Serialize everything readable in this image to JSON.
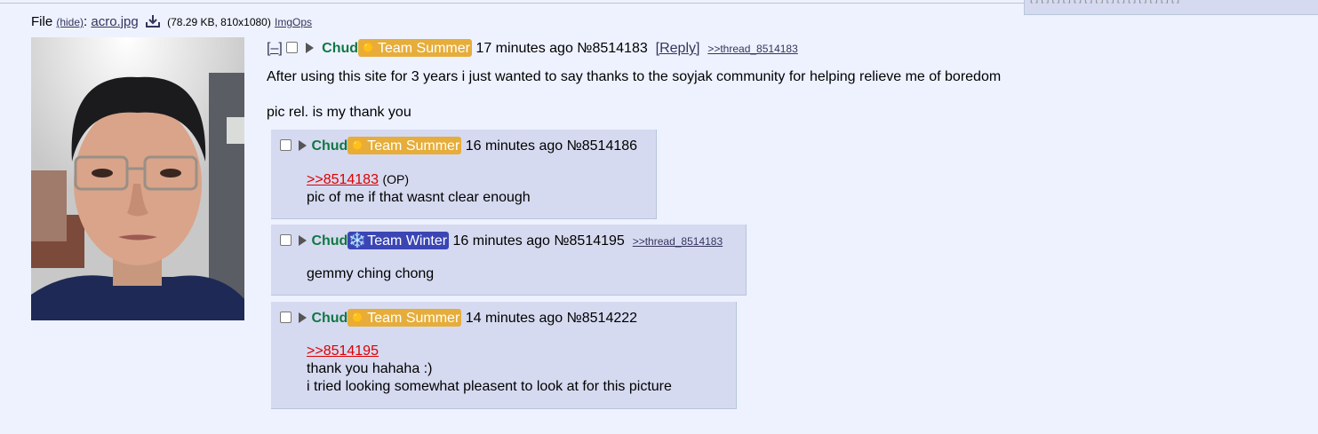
{
  "pagination_fragments": [
    "[",
    ")",
    "]",
    "[",
    "]",
    "[",
    "]",
    "[",
    "]",
    "[",
    "]",
    "[",
    "]",
    "[",
    "]",
    "[",
    "]",
    "[",
    "]",
    "[",
    "]",
    "[",
    "]"
  ],
  "file": {
    "label": "File",
    "hide": "(hide)",
    "name": "acro.jpg",
    "size": "(78.29 KB, 810x1080)",
    "imgops": "ImgOps",
    "icon": "download-icon"
  },
  "op": {
    "hide": "[–]",
    "name": "Chud",
    "flag": "Team Summer",
    "flag_icon": "sun-icon",
    "flag_color": "#e6ad3a",
    "time": "17 minutes ago",
    "number": "№8514183",
    "reply": "[Reply]",
    "thread": ">>thread_8514183",
    "body": [
      "After using this site for 3 years i just wanted to say thanks to the soyjak community for helping relieve me of boredom",
      "pic rel. is my thank you"
    ]
  },
  "replies": [
    {
      "name": "Chud",
      "flag": "Team Summer",
      "flag_icon": "sun-icon",
      "time": "16 minutes ago",
      "number": "№8514186",
      "quote": ">>8514183",
      "quote_tag": "(OP)",
      "lines": [
        "pic of me if that wasnt clear enough"
      ]
    },
    {
      "name": "Chud",
      "flag": "Team Winter",
      "flag_icon": "snowflake-icon",
      "flag_color": "#3b46b4",
      "time": "16 minutes ago",
      "number": "№8514195",
      "thread": ">>thread_8514183",
      "lines": [
        "gemmy ching chong"
      ]
    },
    {
      "name": "Chud",
      "flag": "Team Summer",
      "flag_icon": "sun-icon",
      "time": "14 minutes ago",
      "number": "№8514222",
      "quote": ">>8514195",
      "lines": [
        "thank you hahaha :)",
        "i tried looking somewhat pleasent to look at for this picture"
      ]
    }
  ]
}
